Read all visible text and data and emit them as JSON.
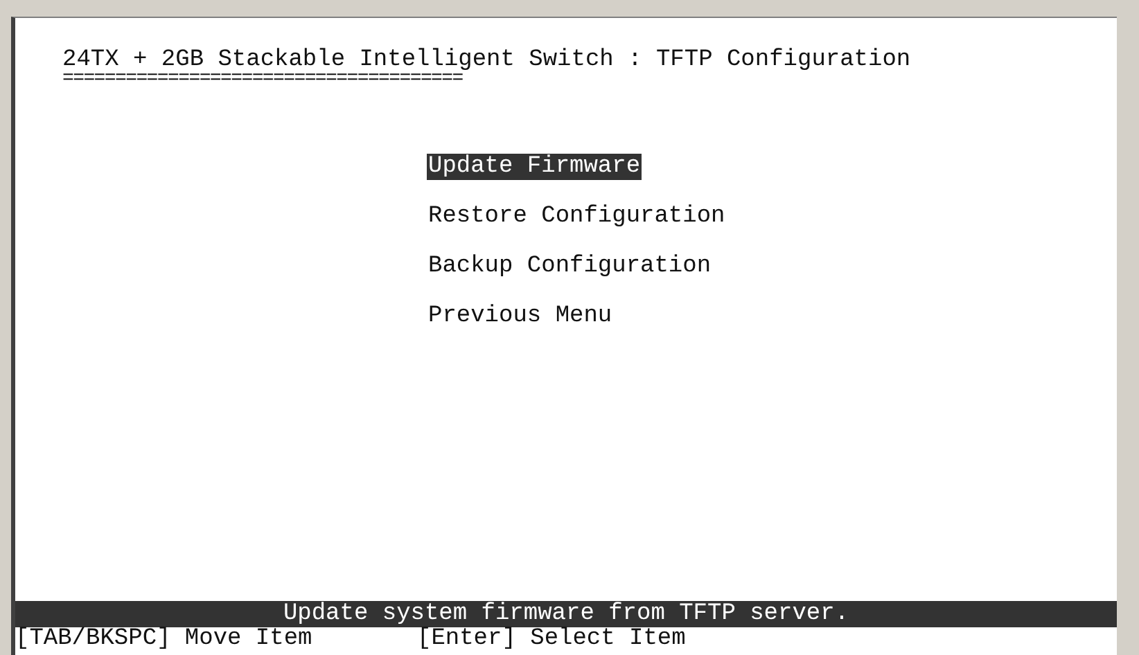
{
  "title": "24TX + 2GB Stackable Intelligent Switch : TFTP Configuration",
  "title_underline": "======================================",
  "menu": [
    {
      "label": "Update Firmware",
      "selected": true
    },
    {
      "label": "Restore Configuration",
      "selected": false
    },
    {
      "label": "Backup Configuration",
      "selected": false
    },
    {
      "label": "Previous Menu",
      "selected": false
    }
  ],
  "status_message": "Update system firmware from TFTP server.",
  "key_hints": [
    "[TAB/BKSPC] Move Item",
    "[Enter] Select Item"
  ]
}
